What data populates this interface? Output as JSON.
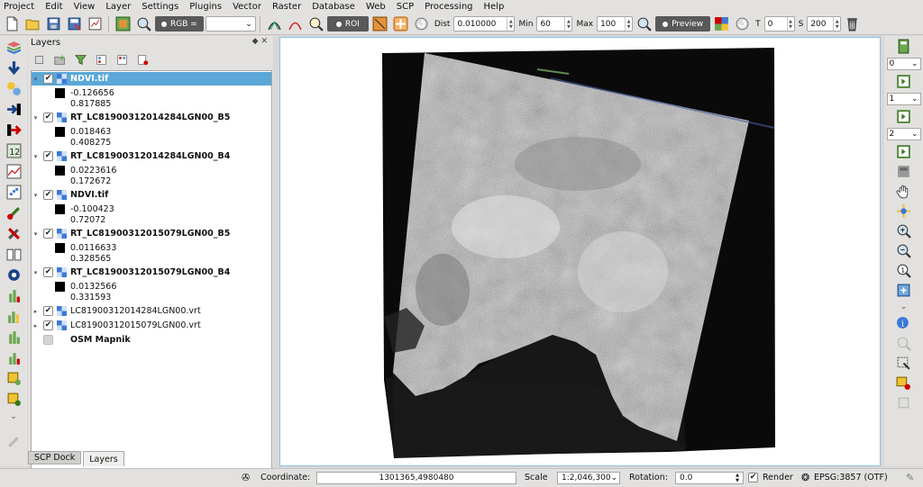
{
  "menu": [
    "Project",
    "Edit",
    "View",
    "Layer",
    "Settings",
    "Plugins",
    "Vector",
    "Raster",
    "Database",
    "Web",
    "SCP",
    "Processing",
    "Help"
  ],
  "toolbar": {
    "rgb_label": "RGB =",
    "roi_label": "ROI",
    "dist_label": "Dist",
    "dist_value": "0.010000",
    "min_label": "Min",
    "min_value": "60",
    "max_label": "Max",
    "max_value": "100",
    "preview_label": "Preview",
    "t_label": "T",
    "t_value": "0",
    "s_label": "S",
    "s_value": "200"
  },
  "layers_panel": {
    "title": "Layers",
    "controls": "◆ ✕",
    "layers": [
      {
        "name": "NDVI.tif",
        "checked": true,
        "expanded": true,
        "selected": true,
        "min": "-0.126656",
        "max": "0.817885"
      },
      {
        "name": "RT_LC81900312014284LGN00_B5",
        "checked": true,
        "expanded": true,
        "min": "0.018463",
        "max": "0.408275"
      },
      {
        "name": "RT_LC81900312014284LGN00_B4",
        "checked": true,
        "expanded": true,
        "min": "0.0223616",
        "max": "0.172672"
      },
      {
        "name": "NDVI.tif",
        "checked": true,
        "expanded": true,
        "min": "-0.100423",
        "max": "0.72072"
      },
      {
        "name": "RT_LC81900312015079LGN00_B5",
        "checked": true,
        "expanded": true,
        "min": "0.0116633",
        "max": "0.328565"
      },
      {
        "name": "RT_LC81900312015079LGN00_B4",
        "checked": true,
        "expanded": true,
        "min": "0.0132566",
        "max": "0.331593"
      },
      {
        "name": "LC81900312014284LGN00.vrt",
        "checked": true,
        "expanded": false
      },
      {
        "name": "LC81900312015079LGN00.vrt",
        "checked": true,
        "expanded": false
      },
      {
        "name": "OSM Mapnik",
        "checked": false,
        "expanded": false
      }
    ]
  },
  "dock_tabs": [
    "SCP Dock",
    "Layers"
  ],
  "right_toolbar": {
    "band_r": "0",
    "band_g": "1",
    "band_b": "2"
  },
  "statusbar": {
    "coordinate_label": "Coordinate:",
    "coordinate_value": "1301365,4980480",
    "scale_label": "Scale",
    "scale_value": "1:2,046,300",
    "rotation_label": "Rotation:",
    "rotation_value": "0.0",
    "render_label": "Render",
    "crs_label": "EPSG:3857 (OTF)"
  }
}
